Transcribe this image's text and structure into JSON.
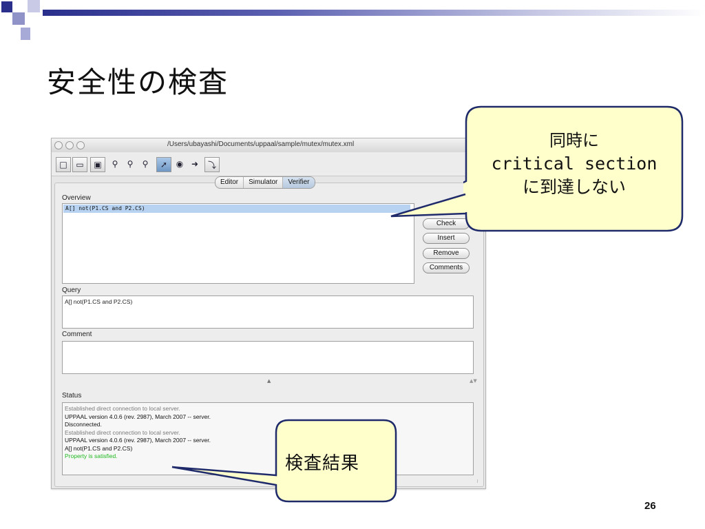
{
  "slide": {
    "title": "安全性の検査",
    "page_number": "26"
  },
  "window": {
    "title": "/Users/ubayashi/Documents/uppaal/sample/mutex/mutex.xml"
  },
  "toolbar": {
    "buttons": [
      "new-document-icon",
      "open-folder-icon",
      "save-icon",
      "zoom-in-icon",
      "zoom-out-icon",
      "zoom-fit-icon",
      "select-tool-icon",
      "location-tool-icon",
      "edge-tool-icon",
      "nail-tool-icon"
    ]
  },
  "tabs": [
    {
      "label": "Editor",
      "selected": false
    },
    {
      "label": "Simulator",
      "selected": false
    },
    {
      "label": "Verifier",
      "selected": true
    }
  ],
  "verifier": {
    "overview_label": "Overview",
    "overview_query": "A[] not(P1.CS and P2.CS)",
    "buttons": {
      "check": "Check",
      "insert": "Insert",
      "remove": "Remove",
      "comments": "Comments"
    },
    "query_label": "Query",
    "query_value": "A[] not(P1.CS and P2.CS)",
    "comment_label": "Comment",
    "comment_value": "",
    "status_label": "Status",
    "status_lines": [
      {
        "text": "Established direct connection to local server.",
        "color": "#7a7a7a"
      },
      {
        "text": "UPPAAL version 4.0.6 (rev. 2987), March 2007 -- server.",
        "color": "#111111"
      },
      {
        "text": "Disconnected.",
        "color": "#111111"
      },
      {
        "text": "Established direct connection to local server.",
        "color": "#7a7a7a"
      },
      {
        "text": "UPPAAL version 4.0.6 (rev. 2987), March 2007 -- server.",
        "color": "#111111"
      },
      {
        "text": "A[] not(P1.CS and P2.CS)",
        "color": "#111111"
      },
      {
        "text": "Property is satisfied.",
        "color": "#1fb81f"
      }
    ]
  },
  "callouts": {
    "critical_section": {
      "line1": "同時に",
      "line2": "critical section",
      "line3": "に到達しない"
    },
    "result": {
      "text": "検査結果"
    }
  },
  "colors": {
    "callout_fill": "#ffffcc",
    "callout_border": "#1f2a6b",
    "title_bar_accent": "#2a2f8c",
    "selected_row": "#b7d3f1",
    "satisfied_green": "#1fb81f"
  }
}
